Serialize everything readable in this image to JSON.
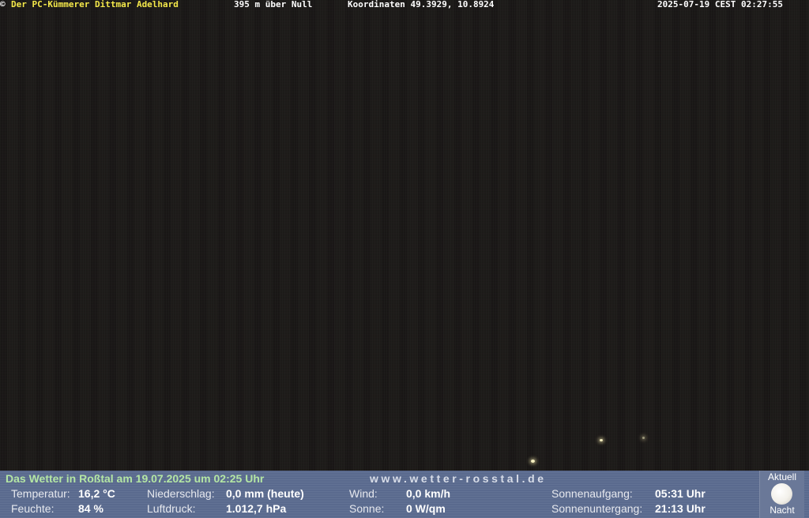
{
  "overlay": {
    "copyright_symbol": "©",
    "owner": "Der PC-Kümmerer Dittmar Adelhard",
    "altitude": "395 m über Null",
    "coordinates": "Koordinaten 49.3929, 10.8924",
    "timestamp": "2025-07-19 CEST 02:27:55"
  },
  "weather": {
    "title": "Das Wetter in Roßtal am 19.07.2025 um 02:25 Uhr",
    "website": "www.wetter-rosstal.de",
    "temperature": {
      "label": "Temperatur:",
      "value": "16,2 °C"
    },
    "humidity": {
      "label": "Feuchte:",
      "value": "84 %"
    },
    "precipitation": {
      "label": "Niederschlag:",
      "value": "0,0 mm (heute)"
    },
    "pressure": {
      "label": "Luftdruck:",
      "value": "1.012,7 hPa"
    },
    "wind": {
      "label": "Wind:",
      "value": "0,0 km/h"
    },
    "sun": {
      "label": "Sonne:",
      "value": "0 W/qm"
    },
    "sunrise": {
      "label": "Sonnenaufgang:",
      "value": "05:31 Uhr"
    },
    "sunset": {
      "label": "Sonnenuntergang:",
      "value": "21:13 Uhr"
    },
    "status": {
      "top": "Aktuell",
      "bottom": "Nacht",
      "icon": "full-moon-icon"
    }
  },
  "colors": {
    "owner_text": "#f4e84a",
    "title_text": "#b4e6a4",
    "panel_background": "#5a6a8e"
  }
}
